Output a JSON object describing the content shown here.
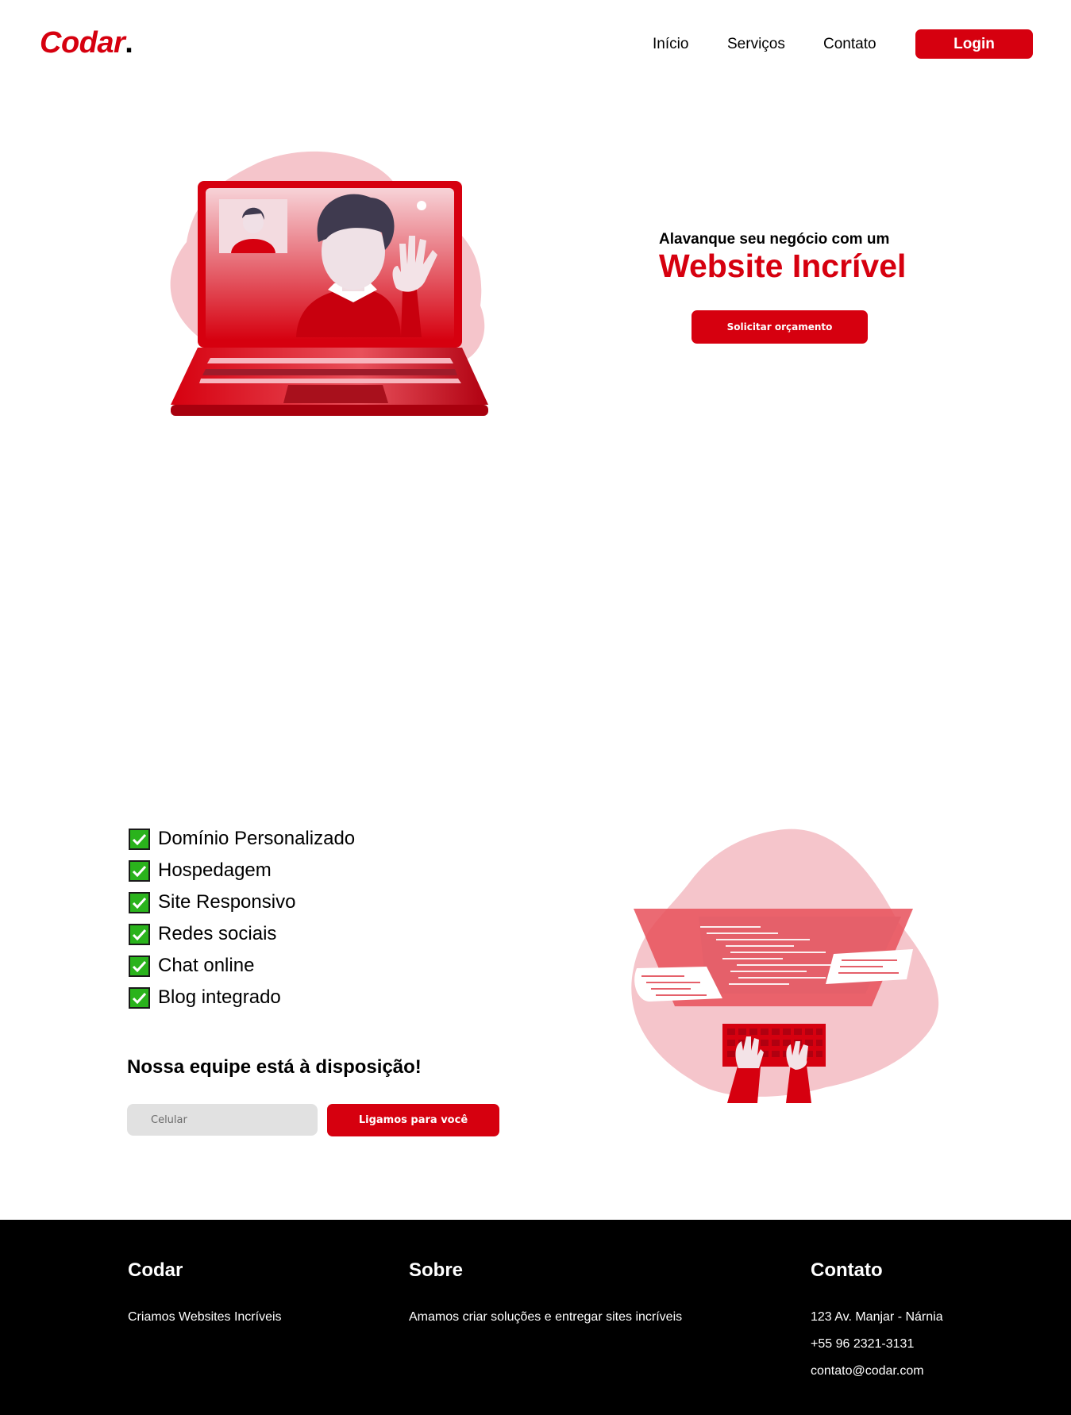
{
  "header": {
    "logo": "Codar",
    "logo_dot": ".",
    "nav": [
      {
        "label": "Início"
      },
      {
        "label": "Serviços"
      },
      {
        "label": "Contato"
      }
    ],
    "login_label": "Login"
  },
  "hero": {
    "subtitle": "Alavanque seu negócio com um",
    "title": "Website Incrível",
    "cta_label": "Solicitar orçamento",
    "illustration_icon": "laptop-video-call-illustration"
  },
  "features": {
    "check_icon": "checkbox-checked-icon",
    "items": [
      {
        "label": "Domínio Personalizado"
      },
      {
        "label": "Hospedagem"
      },
      {
        "label": "Site Responsivo"
      },
      {
        "label": "Redes sociais"
      },
      {
        "label": "Chat online"
      },
      {
        "label": "Blog integrado"
      }
    ]
  },
  "contact_form": {
    "heading": "Nossa equipe está à disposição!",
    "phone_placeholder": "Celular",
    "button_label": "Ligamos para você"
  },
  "coding_illustration_icon": "developer-keyboard-illustration",
  "footer": {
    "codar": {
      "title": "Codar",
      "text": "Criamos Websites Incríveis"
    },
    "sobre": {
      "title": "Sobre",
      "text": "Amamos criar soluções e entregar sites incríveis"
    },
    "contato": {
      "title": "Contato",
      "address": "123 Av. Manjar - Nárnia",
      "phone": "+55 96 2321-3131",
      "email": "contato@codar.com"
    }
  },
  "colors": {
    "brand_red": "#d6000f",
    "blob_pink": "#f5c5cb",
    "check_green": "#2ab31c",
    "footer_bg": "#000000"
  }
}
